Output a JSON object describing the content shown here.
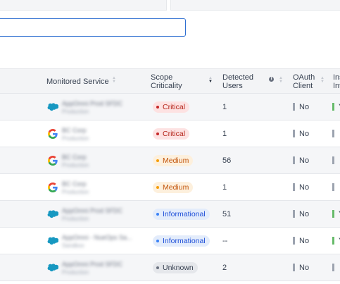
{
  "table": {
    "columns": [
      {
        "key": "service",
        "label": "Monitored Service"
      },
      {
        "key": "scope",
        "label": "Scope\nCriticality"
      },
      {
        "key": "users",
        "label": "Detected\nUsers"
      },
      {
        "key": "oauth",
        "label": "OAuth\nClient"
      },
      {
        "key": "ins",
        "label": "Ins\nInt"
      }
    ],
    "rows": [
      {
        "service_icon": "salesforce-icon",
        "service_name": "AppOmni Prod SFDC",
        "service_env": "Production",
        "scope": "Critical",
        "users": "1",
        "oauth": "No",
        "ins": "Y"
      },
      {
        "service_icon": "google-icon",
        "service_name": "BC Corp",
        "service_env": "Production",
        "scope": "Critical",
        "users": "1",
        "oauth": "No",
        "ins": ""
      },
      {
        "service_icon": "google-icon",
        "service_name": "BC Corp",
        "service_env": "Production",
        "scope": "Medium",
        "users": "56",
        "oauth": "No",
        "ins": ""
      },
      {
        "service_icon": "google-icon",
        "service_name": "BC Corp",
        "service_env": "Production",
        "scope": "Medium",
        "users": "1",
        "oauth": "No",
        "ins": ""
      },
      {
        "service_icon": "salesforce-icon",
        "service_name": "AppOmni Prod SFDC",
        "service_env": "Production",
        "scope": "Informational",
        "users": "51",
        "oauth": "No",
        "ins": "Y"
      },
      {
        "service_icon": "salesforce-icon",
        "service_name": "AppOmni - NueOps Sa...",
        "service_env": "Sandbox",
        "scope": "Informational",
        "users": "--",
        "oauth": "No",
        "ins": "Y"
      },
      {
        "service_icon": "salesforce-icon",
        "service_name": "AppOmni Prod SFDC",
        "service_env": "Production",
        "scope": "Unknown",
        "users": "2",
        "oauth": "No",
        "ins": ""
      }
    ],
    "ins_colors": [
      "green",
      "grey",
      "grey",
      "grey",
      "green",
      "green",
      "grey"
    ]
  },
  "colors": {
    "accent": "#2f6fd1",
    "critical": "#c62828",
    "medium": "#f59e0b",
    "informational": "#3b82f6",
    "unknown": "#6b7280",
    "yes_bar": "#66bb6a",
    "no_bar": "#9ca3af"
  }
}
